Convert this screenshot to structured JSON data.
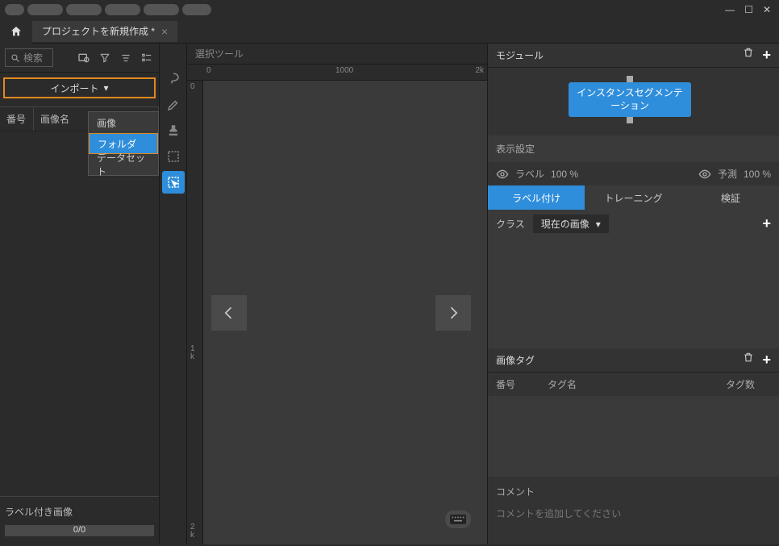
{
  "tab_title": "プロジェクトを新規作成 *",
  "search_placeholder": "検索",
  "import_label": "インポート",
  "import_menu": {
    "image": "画像",
    "folder": "フォルダ",
    "dataset": "データセット"
  },
  "left_table": {
    "col_number": "番号",
    "col_imgname": "画像名"
  },
  "labeled_images_label": "ラベル付き画像",
  "progress_text": "0/0",
  "canvas_tool_label": "選択ツール",
  "ruler": {
    "h0": "0",
    "h1000": "1000",
    "h2k": "2k",
    "v0": "0",
    "v1k": "1 k",
    "v2k": "2 k"
  },
  "right": {
    "module_title": "モジュール",
    "module_node": "インスタンスセグメンテーション",
    "display_settings": "表示設定",
    "label_text": "ラベル",
    "label_pct": "100 %",
    "predict_text": "予測",
    "predict_pct": "100 %",
    "tab_labeling": "ラベル付け",
    "tab_training": "トレーニング",
    "tab_validation": "検証",
    "class_label": "クラス",
    "class_value": "現在の画像",
    "imgtag_title": "画像タグ",
    "imgtag_col_num": "番号",
    "imgtag_col_name": "タグ名",
    "imgtag_col_count": "タグ数",
    "comment_title": "コメント",
    "comment_placeholder": "コメントを追加してください"
  }
}
